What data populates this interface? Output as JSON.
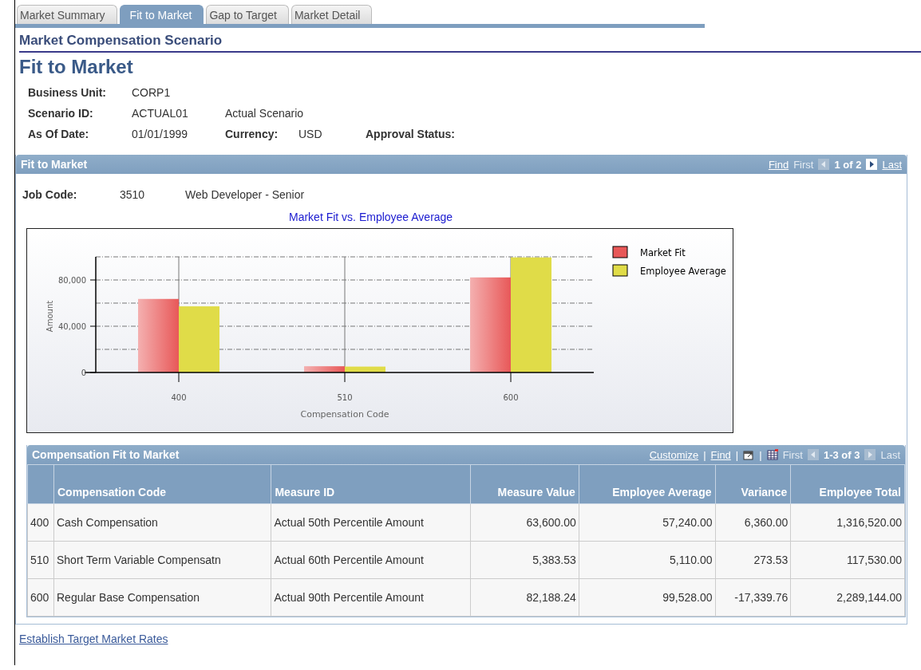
{
  "tabs": [
    {
      "label": "Market Summary",
      "selected": false
    },
    {
      "label": "Fit to Market",
      "selected": true
    },
    {
      "label": "Gap to Target",
      "selected": false
    },
    {
      "label": "Market Detail",
      "selected": false
    }
  ],
  "component_title": "Market Compensation Scenario",
  "page_title": "Fit to Market",
  "header_fields": {
    "business_unit": {
      "label": "Business Unit:",
      "value": "CORP1"
    },
    "scenario_id": {
      "label": "Scenario ID:",
      "value": "ACTUAL01",
      "description": "Actual Scenario"
    },
    "as_of_date": {
      "label": "As Of Date:",
      "value": "01/01/1999"
    },
    "currency": {
      "label": "Currency:",
      "value": "USD"
    },
    "approval_status": {
      "label": "Approval Status:"
    }
  },
  "fit_panel": {
    "title": "Fit to Market",
    "nav": {
      "find": "Find",
      "first": {
        "label": "First",
        "disabled": true
      },
      "position": "1 of 2",
      "last": {
        "label": "Last",
        "disabled": false
      }
    },
    "job_code": {
      "label": "Job Code:",
      "value": "3510",
      "description": "Web Developer - Senior"
    },
    "chart_title": "Market Fit vs. Employee Average",
    "chart_data": {
      "type": "bar",
      "xlabel": "Compensation Code",
      "ylabel": "Amount",
      "categories": [
        "400",
        "510",
        "600"
      ],
      "series": [
        {
          "name": "Market Fit",
          "color": "#e85858",
          "values": [
            63600,
            5400,
            82200
          ]
        },
        {
          "name": "Employee Average",
          "color": "#e0dc48",
          "values": [
            57200,
            5100,
            99500
          ]
        }
      ],
      "grid": true,
      "legend": true,
      "ylim": [
        0,
        100000
      ],
      "yticks": [
        {
          "value": 0,
          "label": "0"
        },
        {
          "value": 40000,
          "label": "40,000"
        },
        {
          "value": 80000,
          "label": "80,000"
        }
      ]
    }
  },
  "grid": {
    "title": "Compensation Fit to Market",
    "nav": {
      "customize": "Customize",
      "separators": [
        "|",
        "|",
        "|"
      ],
      "find": "Find",
      "first": {
        "label": "First",
        "disabled": true
      },
      "position": "1-3 of 3",
      "last": {
        "label": "Last",
        "disabled": true
      }
    },
    "columns": [
      "",
      "Compensation Code",
      "Measure ID",
      "Measure Value",
      "Employee Average",
      "Variance",
      "Employee Total"
    ],
    "rows": [
      {
        "cells": [
          "400",
          "Cash Compensation",
          "Actual 50th Percentile Amount",
          "63,600.00",
          "57,240.00",
          "6,360.00",
          "1,316,520.00"
        ]
      },
      {
        "cells": [
          "510",
          "Short Term Variable Compensatn",
          "Actual 60th Percentile Amount",
          "5,383.53",
          "5,110.00",
          "273.53",
          "117,530.00"
        ]
      },
      {
        "cells": [
          "600",
          "Regular Base Compensation",
          "Actual 90th Percentile Amount",
          "82,188.24",
          "99,528.00",
          "-17,339.76",
          "2,289,144.00"
        ]
      }
    ]
  },
  "footer_link": "Establish Target Market Rates"
}
